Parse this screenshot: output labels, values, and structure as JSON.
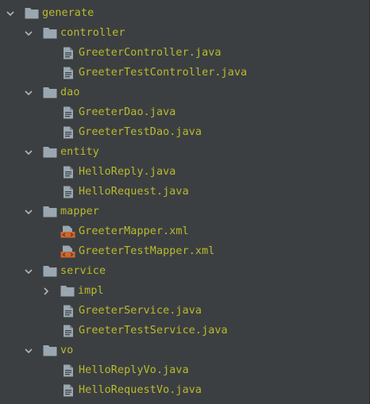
{
  "project_tree": {
    "root": {
      "label": "generate",
      "expanded": true,
      "icon": "folder-icon"
    },
    "folders": [
      {
        "label": "controller",
        "expanded": true,
        "icon": "folder-icon",
        "files": [
          {
            "label": "GreeterController.java",
            "icon": "java-file-icon"
          },
          {
            "label": "GreeterTestController.java",
            "icon": "java-file-icon"
          }
        ]
      },
      {
        "label": "dao",
        "expanded": true,
        "icon": "folder-icon",
        "files": [
          {
            "label": "GreeterDao.java",
            "icon": "java-file-icon"
          },
          {
            "label": "GreeterTestDao.java",
            "icon": "java-file-icon"
          }
        ]
      },
      {
        "label": "entity",
        "expanded": true,
        "icon": "folder-icon",
        "files": [
          {
            "label": "HelloReply.java",
            "icon": "java-file-icon"
          },
          {
            "label": "HelloRequest.java",
            "icon": "java-file-icon"
          }
        ]
      },
      {
        "label": "mapper",
        "expanded": true,
        "icon": "folder-icon",
        "files": [
          {
            "label": "GreeterMapper.xml",
            "icon": "xml-file-icon"
          },
          {
            "label": "GreeterTestMapper.xml",
            "icon": "xml-file-icon"
          }
        ]
      },
      {
        "label": "service",
        "expanded": true,
        "icon": "folder-icon",
        "subfolders": [
          {
            "label": "impl",
            "expanded": false,
            "icon": "folder-icon"
          }
        ],
        "files": [
          {
            "label": "GreeterService.java",
            "icon": "java-file-icon"
          },
          {
            "label": "GreeterTestService.java",
            "icon": "java-file-icon"
          }
        ]
      },
      {
        "label": "vo",
        "expanded": true,
        "icon": "folder-icon",
        "files": [
          {
            "label": "HelloReplyVo.java",
            "icon": "java-file-icon"
          },
          {
            "label": "HelloRequestVo.java",
            "icon": "java-file-icon"
          }
        ]
      }
    ]
  },
  "colors": {
    "background": "#3c3f41",
    "label_text": "#b9bb2d",
    "folder_icon": "#9aa7b0",
    "file_icon": "#9aa7b0",
    "xml_icon": "#d1652b",
    "arrow": "#a9b7c6"
  }
}
